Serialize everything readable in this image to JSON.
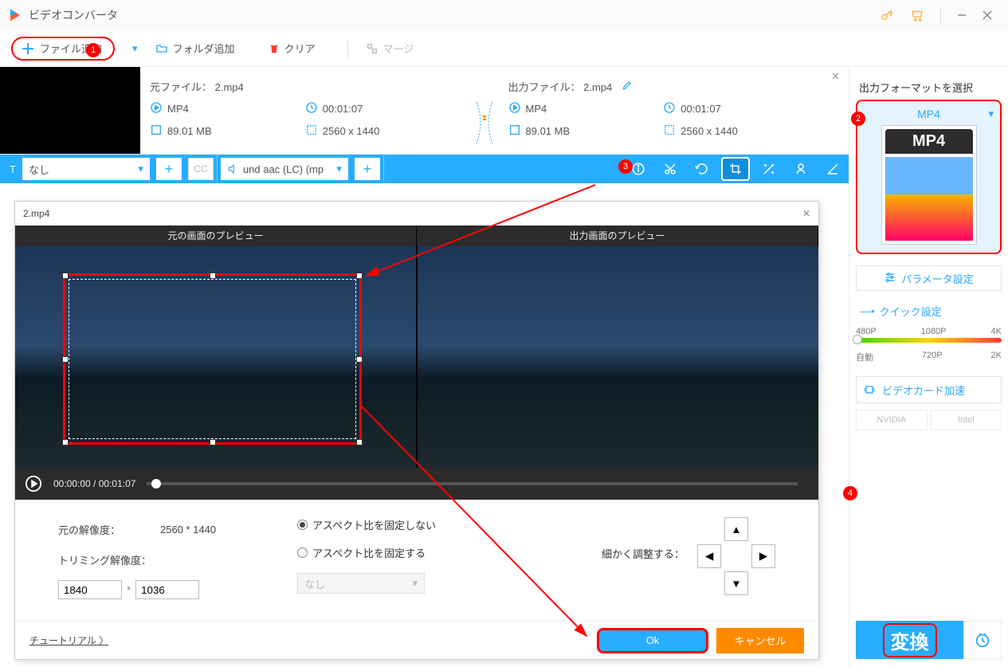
{
  "titlebar": {
    "title": "ビデオコンバータ"
  },
  "toolbar": {
    "add_file": "ファイル追加",
    "add_folder": "フォルダ追加",
    "clear": "クリア",
    "merge": "マージ"
  },
  "file": {
    "src": {
      "header": "元ファイル： 2.mp4",
      "format": "MP4",
      "duration": "00:01:07",
      "size": "89.01 MB",
      "resolution": "2560 x 1440"
    },
    "dst": {
      "header": "出力ファイル： 2.mp4",
      "format": "MP4",
      "duration": "00:01:07",
      "size": "89.01 MB",
      "resolution": "2560 x 1440"
    }
  },
  "strip": {
    "subtitle_none": "なし",
    "cc": "CC",
    "audio_track": "und aac (LC) (mp"
  },
  "right": {
    "title": "出力フォーマットを選択",
    "format": "MP4",
    "format_badge": "MP4",
    "param_settings": "パラメータ設定",
    "quick_settings": "クイック設定",
    "scale_top": {
      "a": "480P",
      "b": "1080P",
      "c": "4K"
    },
    "scale_bot": {
      "a": "自動",
      "b": "720P",
      "c": "2K"
    },
    "gpu_accel": "ビデオカード加速",
    "nvidia": "NVIDIA",
    "intel": "Intel",
    "convert": "変換"
  },
  "dialog": {
    "title": "2.mp4",
    "head_src": "元の画面のプレビュー",
    "head_dst": "出力画面のプレビュー",
    "time_cur": "00:00:00",
    "time_total": "00:01:07",
    "orig_res_label": "元の解像度：",
    "orig_res": "2560 * 1440",
    "trim_label": "トリミング解像度：",
    "trim_w": "1840",
    "trim_h": "1036",
    "aspect_free": "アスペクト比を固定しない",
    "aspect_lock": "アスペクト比を固定する",
    "aspect_none": "なし",
    "fine_adjust": "細かく調整する：",
    "tutorial": "チュートリアル 〉",
    "ok": "Ok",
    "cancel": "キャンセル"
  },
  "badges": {
    "b1": "1",
    "b2": "2",
    "b3": "3",
    "b4": "4"
  }
}
